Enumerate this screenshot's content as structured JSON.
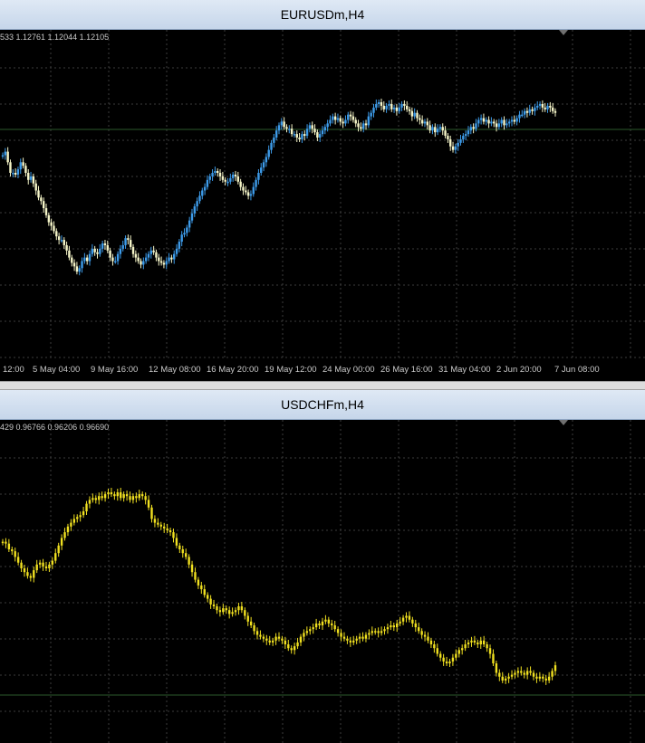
{
  "windows": [
    {
      "id": "eurusd",
      "title": "EURUSDm,H4",
      "ohlc_text": "533 1.12761 1.12044 1.12105",
      "colors": {
        "bull": "#3d9be9",
        "bear": "#f5f5c8",
        "grid": "#3c3c3c",
        "level": "#2d5a2d"
      },
      "x_ticks": [
        "12:00",
        "5 May 04:00",
        "9 May 16:00",
        "12 May 08:00",
        "16 May 20:00",
        "19 May 12:00",
        "24 May 00:00",
        "26 May 16:00",
        "31 May 04:00",
        "2 Jun 20:00",
        "7 Jun 08:00"
      ]
    },
    {
      "id": "usdchf",
      "title": "USDCHFm,H4",
      "ohlc_text": "429 0.96766 0.96206 0.96690",
      "colors": {
        "bull": "#f0e020",
        "bear": "#f0e020",
        "grid": "#3c3c3c",
        "level": "#2d5a2d"
      }
    }
  ],
  "chart_data": [
    {
      "type": "candlestick",
      "symbol": "EURUSDm",
      "timeframe": "H4",
      "series_shape": [
        0.7,
        0.72,
        0.66,
        0.6,
        0.6,
        0.59,
        0.62,
        0.66,
        0.64,
        0.6,
        0.56,
        0.58,
        0.54,
        0.5,
        0.46,
        0.44,
        0.4,
        0.36,
        0.32,
        0.3,
        0.27,
        0.24,
        0.22,
        0.22,
        0.19,
        0.16,
        0.12,
        0.09,
        0.07,
        0.04,
        0.06,
        0.1,
        0.12,
        0.1,
        0.14,
        0.17,
        0.15,
        0.14,
        0.17,
        0.2,
        0.19,
        0.16,
        0.12,
        0.1,
        0.1,
        0.14,
        0.17,
        0.19,
        0.23,
        0.22,
        0.18,
        0.14,
        0.12,
        0.1,
        0.08,
        0.1,
        0.12,
        0.14,
        0.16,
        0.15,
        0.12,
        0.1,
        0.09,
        0.08,
        0.1,
        0.12,
        0.11,
        0.14,
        0.17,
        0.21,
        0.25,
        0.26,
        0.29,
        0.33,
        0.37,
        0.41,
        0.44,
        0.47,
        0.5,
        0.52,
        0.56,
        0.58,
        0.6,
        0.61,
        0.6,
        0.58,
        0.56,
        0.55,
        0.55,
        0.57,
        0.59,
        0.58,
        0.55,
        0.52,
        0.5,
        0.49,
        0.47,
        0.48,
        0.52,
        0.56,
        0.6,
        0.63,
        0.66,
        0.69,
        0.73,
        0.77,
        0.8,
        0.84,
        0.87,
        0.89,
        0.86,
        0.85,
        0.85,
        0.82,
        0.82,
        0.8,
        0.79,
        0.82,
        0.81,
        0.85,
        0.87,
        0.85,
        0.83,
        0.8,
        0.82,
        0.84,
        0.86,
        0.88,
        0.9,
        0.92,
        0.9,
        0.91,
        0.89,
        0.88,
        0.9,
        0.93,
        0.92,
        0.9,
        0.88,
        0.86,
        0.85,
        0.88,
        0.87,
        0.92,
        0.94,
        0.97,
        0.99,
        1.0,
        0.98,
        0.96,
        0.98,
        0.99,
        0.96,
        0.97,
        0.95,
        0.97,
        0.99,
        0.98,
        0.96,
        0.95,
        0.92,
        0.94,
        0.91,
        0.9,
        0.88,
        0.89,
        0.87,
        0.84,
        0.86,
        0.83,
        0.85,
        0.86,
        0.84,
        0.81,
        0.79,
        0.75,
        0.73,
        0.75,
        0.77,
        0.79,
        0.81,
        0.82,
        0.84,
        0.86,
        0.85,
        0.88,
        0.9,
        0.91,
        0.89,
        0.9,
        0.88,
        0.89,
        0.88,
        0.86,
        0.88,
        0.9,
        0.87,
        0.88,
        0.89,
        0.9,
        0.89,
        0.91,
        0.93,
        0.93,
        0.95,
        0.94,
        0.96,
        0.95,
        0.97,
        0.98,
        0.99,
        0.97,
        0.96,
        0.98,
        0.97,
        0.95,
        0.94
      ]
    },
    {
      "type": "candlestick",
      "symbol": "USDCHFm",
      "timeframe": "H4",
      "series_shape": [
        0.74,
        0.73,
        0.7,
        0.69,
        0.66,
        0.63,
        0.6,
        0.58,
        0.56,
        0.55,
        0.59,
        0.62,
        0.63,
        0.61,
        0.6,
        0.62,
        0.64,
        0.68,
        0.72,
        0.76,
        0.79,
        0.82,
        0.84,
        0.86,
        0.87,
        0.88,
        0.9,
        0.94,
        0.96,
        0.97,
        0.96,
        0.98,
        0.97,
        0.99,
        1.0,
        0.99,
        0.98,
        1.0,
        0.97,
        0.99,
        0.98,
        0.96,
        0.98,
        0.97,
        0.99,
        0.98,
        0.96,
        0.92,
        0.86,
        0.84,
        0.83,
        0.82,
        0.81,
        0.8,
        0.79,
        0.76,
        0.72,
        0.7,
        0.68,
        0.66,
        0.62,
        0.58,
        0.54,
        0.51,
        0.49,
        0.46,
        0.44,
        0.41,
        0.4,
        0.38,
        0.37,
        0.39,
        0.38,
        0.36,
        0.37,
        0.38,
        0.4,
        0.38,
        0.35,
        0.32,
        0.3,
        0.27,
        0.25,
        0.24,
        0.23,
        0.22,
        0.21,
        0.22,
        0.24,
        0.23,
        0.22,
        0.2,
        0.18,
        0.17,
        0.19,
        0.21,
        0.24,
        0.26,
        0.27,
        0.28,
        0.29,
        0.31,
        0.3,
        0.32,
        0.33,
        0.31,
        0.3,
        0.28,
        0.26,
        0.24,
        0.23,
        0.22,
        0.21,
        0.22,
        0.23,
        0.24,
        0.23,
        0.25,
        0.26,
        0.27,
        0.27,
        0.26,
        0.27,
        0.28,
        0.29,
        0.3,
        0.29,
        0.31,
        0.32,
        0.34,
        0.35,
        0.33,
        0.31,
        0.29,
        0.27,
        0.25,
        0.24,
        0.22,
        0.2,
        0.18,
        0.15,
        0.13,
        0.11,
        0.1,
        0.11,
        0.13,
        0.15,
        0.17,
        0.18,
        0.2,
        0.21,
        0.22,
        0.21,
        0.2,
        0.22,
        0.2,
        0.18,
        0.15,
        0.1,
        0.05,
        0.03,
        0.01,
        0.02,
        0.03,
        0.04,
        0.05,
        0.06,
        0.05,
        0.04,
        0.06,
        0.05,
        0.03,
        0.02,
        0.03,
        0.02,
        0.01,
        0.03,
        0.06,
        0.09
      ]
    }
  ]
}
